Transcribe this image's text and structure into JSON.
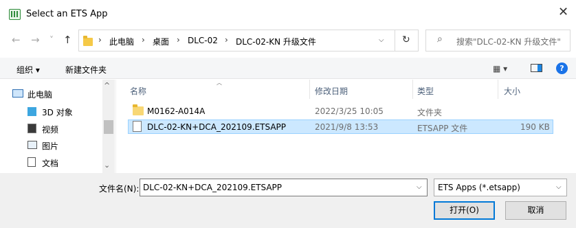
{
  "window": {
    "title": "Select an ETS App",
    "close": "✕"
  },
  "address": {
    "back": "←",
    "forward": "→",
    "recent": "˅",
    "up": "↑",
    "crumbs": [
      "此电脑",
      "桌面",
      "DLC-02",
      "DLC-02-KN 升级文件"
    ],
    "sep": "›",
    "dropdown": "⌵",
    "refresh": "↻"
  },
  "search": {
    "icon": "⌕",
    "placeholder": "搜索\"DLC-02-KN 升级文件\""
  },
  "toolbar": {
    "organize": "组织 ▾",
    "new_folder": "新建文件夹",
    "view": "▦ ▾",
    "help": "?"
  },
  "sidebar": {
    "items": [
      {
        "label": "此电脑",
        "icon": "computer-icon"
      },
      {
        "label": "3D 对象",
        "icon": "3d-objects-icon"
      },
      {
        "label": "视频",
        "icon": "video-icon"
      },
      {
        "label": "图片",
        "icon": "pictures-icon"
      },
      {
        "label": "文档",
        "icon": "documents-icon"
      }
    ],
    "scroll_up": "^",
    "scroll_down": "⌄"
  },
  "file_list": {
    "columns": [
      "名称",
      "修改日期",
      "类型",
      "大小"
    ],
    "rows": [
      {
        "name": "M0162-A014A",
        "date": "2022/3/25 10:05",
        "type": "文件夹",
        "size": "",
        "icon": "folder-icon",
        "selected": false
      },
      {
        "name": "DLC-02-KN+DCA_202109.ETSAPP",
        "date": "2021/9/8 13:53",
        "type": "ETSAPP 文件",
        "size": "190 KB",
        "icon": "file-icon",
        "selected": true
      }
    ]
  },
  "bottom": {
    "filename_label": "文件名(N):",
    "filename_value": "DLC-02-KN+DCA_202109.ETSAPP",
    "filter": "ETS Apps (*.etsapp)",
    "open": "打开(O)",
    "cancel": "取消"
  },
  "colors": {
    "selection": "#cce8ff",
    "accent": "#0078d7",
    "help": "#1a73e8"
  }
}
